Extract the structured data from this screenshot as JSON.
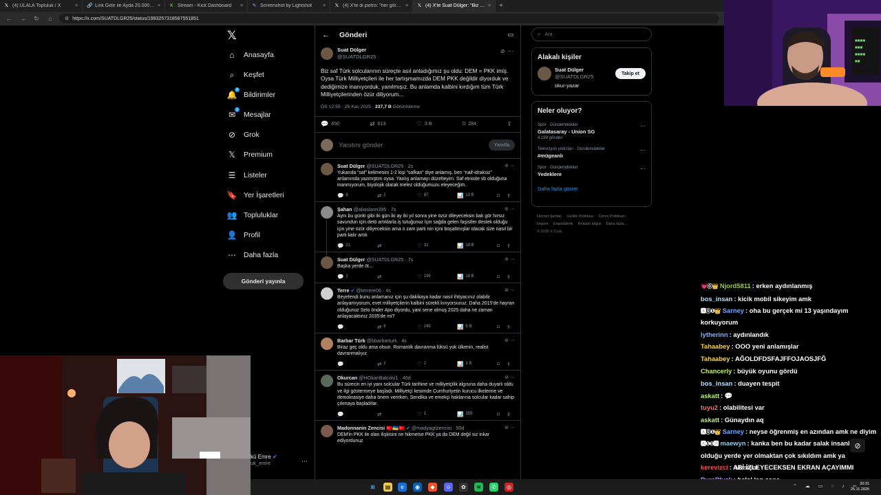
{
  "browser": {
    "tabs": [
      {
        "label": "(4) ULALA Topluluk / X",
        "icon": "x-icon",
        "active": false
      },
      {
        "label": "Link Gelir ile Ayda 20.000 TL Kazan",
        "icon": "link-icon",
        "active": false
      },
      {
        "label": "Stream - Kick Dashboard",
        "icon": "kick-icon",
        "active": false
      },
      {
        "label": "Screenshot by Lightshot",
        "icon": "feather-icon",
        "active": false
      },
      {
        "label": "(4) X'te di pietro: \"her görüşten i...",
        "icon": "x-icon",
        "active": false
      },
      {
        "label": "(4) X'te Suat Dülger: \"Biz saf Türk...",
        "icon": "x-icon",
        "active": true
      }
    ],
    "url": "https://x.com/SUATDLGR25/status/1993257318587551851"
  },
  "nav": {
    "items": [
      {
        "label": "Anasayfa",
        "icon": "home-icon",
        "glyph": "⌂",
        "badge": ""
      },
      {
        "label": "Keşfet",
        "icon": "search-icon",
        "glyph": "⌕",
        "badge": ""
      },
      {
        "label": "Bildirimler",
        "icon": "bell-icon",
        "glyph": "🔔",
        "badge": "4"
      },
      {
        "label": "Mesajlar",
        "icon": "mail-icon",
        "glyph": "✉",
        "badge": "2"
      },
      {
        "label": "Grok",
        "icon": "grok-icon",
        "glyph": "⊘",
        "badge": ""
      },
      {
        "label": "Premium",
        "icon": "x-premium-icon",
        "glyph": "𝕏",
        "badge": ""
      },
      {
        "label": "Listeler",
        "icon": "list-icon",
        "glyph": "☰",
        "badge": ""
      },
      {
        "label": "Yer İşaretleri",
        "icon": "bookmark-icon",
        "glyph": "🔖",
        "badge": ""
      },
      {
        "label": "Topluluklar",
        "icon": "communities-icon",
        "glyph": "👥",
        "badge": ""
      },
      {
        "label": "Profil",
        "icon": "profile-icon",
        "glyph": "👤",
        "badge": ""
      },
      {
        "label": "Daha fazla",
        "icon": "more-icon",
        "glyph": "⋯",
        "badge": ""
      }
    ],
    "post_button": "Gönderi yayınla",
    "account_name": "kü Emre",
    "account_handle": "uk_emre"
  },
  "main": {
    "header_title": "Gönderi",
    "post": {
      "name": "Suat Dülger",
      "handle": "@SUATDLGR25",
      "text": "Biz saf Türk solcularının süreçte asıl anladığımız şu oldu: DEM = PKK imiş. Oysa Türk Milliyetçileri ile her tartışmamızda DEM PKK değildir diyorduk ve dediğimize inanıyorduk, yanılmışız. Bu anlamda kalbini kırdığım tüm Türk Milliyetçilerinden özür diliyorum...",
      "time": "ÖS 12:55 · 25 Kas 2025 ·",
      "views": "237,7 B",
      "views_label": "Görüntüleme",
      "replies": "450",
      "reposts": "613",
      "likes": "3 B",
      "bookmarks": "284"
    },
    "reply_box": {
      "placeholder": "Yanıtını gönder",
      "button": "Yanıtla"
    },
    "replies": [
      {
        "name": "Suat Dülger",
        "handle": "@SUATDLGR25 · 2s",
        "verified": false,
        "text": "Yukarıda “saf” kelimesini 1-2 kişi “safkan” diye anlamış, ben “naif-idraksiz” anlamında yazmıştım oysa. Yanlış anlamayı düzelteyim. Saf etnisite vb olduğuna inanmıyorum, biyolojik olarak melez olduğumuzu eleyeceğim.",
        "replies": "6",
        "reposts": "2",
        "likes": "87",
        "views": "13 B",
        "avatar": "#6b5847"
      },
      {
        "name": "Şahan",
        "handle": "@aliaslann395 · 7s",
        "verified": false,
        "text": "Aynı bu günki gibi iki gün iki ay iki yıl sonra yine özür dileyeceksin bak gör hırsız savundun için detö artıklarla iş tutuğunuz  İçin sağda  gelen faşistler destek olduğu için yine özür diliyeceksin ama o zam parti nin içini boşaltmışlar olacak size  nasıl bir parti kalır artık",
        "replies": "21",
        "reposts": "",
        "likes": "31",
        "views": "18 B",
        "avatar": "#8a8a8a"
      },
      {
        "name": "Suat Dülger",
        "handle": "@SUATDLGR25 · 7s",
        "verified": false,
        "text": "Başka yerde öt...",
        "replies": "1",
        "reposts": "",
        "likes": "195",
        "views": "18 B",
        "avatar": "#6b5847"
      },
      {
        "name": "Terre",
        "handle": "@terrere06 · 4s",
        "verified": true,
        "text": "Beyefendi bunu anlamanız için şu dakikaya kadar nasıl ihtiyacınız olabilir anlayamıyorum, evet milliyetçilerin kalbini sürekli kırıyorsunuz. Daha 2015'de hayran olduğunuz Selo önder Apo diyordu, yani sene olmuş 2025 daha ne zaman anlayacaktınız 2035'de mi?",
        "replies": "",
        "reposts": "8",
        "likes": "249",
        "views": "5 B",
        "avatar": "#d0d0d0"
      },
      {
        "name": "Barbar Türk",
        "handle": "@bbarbarturk · 4s",
        "verified": false,
        "text": "Biraz geç oldu ama olsun. Romantik davranma lüksü yok ülkenin, realist davranmalıyız",
        "replies": "",
        "reposts": "2",
        "likes": "2",
        "views": "3 B",
        "avatar": "#b08060"
      },
      {
        "name": "Okurcan",
        "handle": "@HOkanBalcolu1 · 40d",
        "verified": false,
        "text": "Bu sürecin en iyi yanı solcular Türk tarihine ve milliyetçilik algısına daha duyarlı oldu ve ilgi göstermeye başladı. Milliyetçi kesimde Cumhuriyetin kurucu ilkelerine ve demokrasiye daha önem verirken, Sendika ve emekçi haklarına solcular kadar sahip çıkmaya başladılar.",
        "replies": "",
        "reposts": "",
        "likes": "1",
        "views": "359",
        "avatar": "#5a6a5a"
      },
      {
        "name": "Madonnanin Zencisi 🇹🇷🇺🇦🇹🇷",
        "handle": "@madyagilzencisi · 50d",
        "verified": true,
        "text": "DEM'in PKK ile olan ilişkisini ne hikmetse PKK ya da DEM değil siz inkar ediyordunuz",
        "replies": "",
        "reposts": "",
        "likes": "",
        "views": "",
        "avatar": "#7a5a4a"
      }
    ]
  },
  "sidebar": {
    "search_placeholder": "Ara",
    "related_title": "Alakalı kişiler",
    "related": {
      "name": "Suat Dülger",
      "handle": "@SUATDLGR25",
      "bio": "okur-yazar",
      "follow": "Takip et"
    },
    "trends_title": "Neler oluyor?",
    "trends": [
      {
        "category": "Spor · Gündemdekiler",
        "name": "Galatasaray - Union SG",
        "count": "4.199 gönderi"
      },
      {
        "category": "Televizyon yıldızları · Gündemdekiler",
        "name": "#mügeanlı",
        "count": ""
      },
      {
        "category": "Spor · Gündemdekiler",
        "name": "Yedeklere",
        "count": ""
      }
    ],
    "show_more": "Daha fazla göster",
    "footer": [
      "Hizmet Şartları",
      "Gizlilik Politikası",
      "Çerez Politikası",
      "Imprint",
      "Erişilebilirlik",
      "Reklam bilgisi",
      "Daha fazla ...",
      "© 2025 X Corp."
    ]
  },
  "chat": {
    "messages": [
      {
        "badges": "💗⓪👑",
        "user": "Njord5811",
        "color": "#9acd32",
        "text": ": erken aydınlanmış",
        "wrap": false
      },
      {
        "badges": "",
        "user": "bos_insan",
        "color": "#b0e0ff",
        "text": ": kicik mobil sikeyim amk",
        "wrap": false
      },
      {
        "badges": "🅰⓪❶👑",
        "user": "Sarney",
        "color": "#6aa6ff",
        "text": ": oha bu gerçek mi 13 yaşındayım korkuyorum",
        "wrap": true
      },
      {
        "badges": "",
        "user": "lytherinn",
        "color": "#7fb3ff",
        "text": ": aydınlandık",
        "wrap": false
      },
      {
        "badges": "",
        "user": "Tahaabey",
        "color": "#f5d547",
        "text": ": OOO yeni anlamışlar",
        "wrap": false
      },
      {
        "badges": "",
        "user": "Tahaabey",
        "color": "#f5d547",
        "text": ": AĞOLDFDSFAJFFOJAOSJFĞ",
        "wrap": false
      },
      {
        "badges": "",
        "user": "Chancerly",
        "color": "#c6f05a",
        "text": ": büyük oyunu gördü",
        "wrap": false
      },
      {
        "badges": "",
        "user": "bos_insan",
        "color": "#b0e0ff",
        "text": ": duayen tespit",
        "wrap": false
      },
      {
        "badges": "",
        "user": "askatt",
        "color": "#b6f26a",
        "text": ": 💬",
        "wrap": false
      },
      {
        "badges": "",
        "user": "tuyu2",
        "color": "#ff6a6a",
        "text": ": olabilitesi var",
        "wrap": false
      },
      {
        "badges": "",
        "user": "askatt",
        "color": "#b6f26a",
        "text": ": Günaydın aq",
        "wrap": false
      },
      {
        "badges": "🅰⓪❶👑",
        "user": "Sarney",
        "color": "#6aa6ff",
        "text": ": neyse öğrenmiş en azından amk ne diyim",
        "wrap": true
      },
      {
        "badges": "🅰❶❶🅼",
        "user": "maewyn",
        "color": "#7fd0ff",
        "text": ": kanka ben bu kadar salak insanların olduğu yerde yer olmaktan çok sıkıldım amk ya",
        "wrap": true
      },
      {
        "badges": "",
        "user": "kerevizci",
        "color": "#ff4f4f",
        "text": ": ABİ İZLEYECEKSEN EKRAN AÇAYIMMI",
        "wrap": false
      },
      {
        "badges": "",
        "user": "PureBlvck",
        "color": "#c9a0ff",
        "text": ": helal lan sana",
        "wrap": false
      }
    ],
    "overlay_label": "Mesajlar"
  },
  "taskbar": {
    "time": "20:31",
    "date": "25.11.2025"
  }
}
